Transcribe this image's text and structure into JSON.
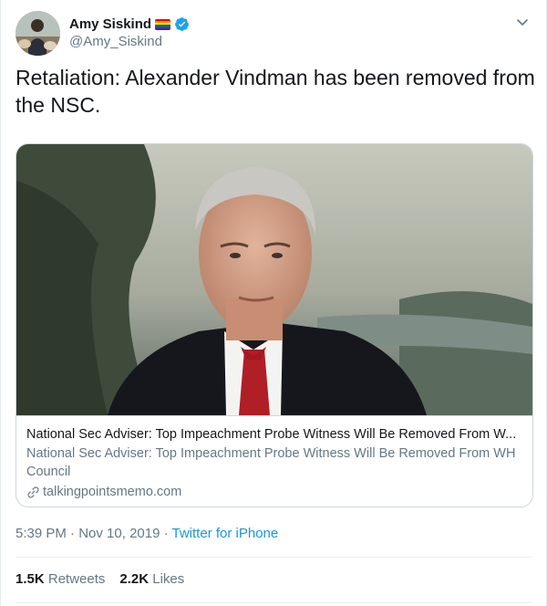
{
  "user": {
    "display_name": "Amy Siskind",
    "handle": "@Amy_Siskind",
    "flag_icon": "rainbow-flag-icon",
    "verified_icon": "verified-badge-icon"
  },
  "tweet": {
    "text": "Retaliation: Alexander Vindman has been removed from the NSC."
  },
  "card": {
    "title": "National Sec Adviser: Top Impeachment Probe Witness Will Be Removed From W...",
    "description": "National Sec Adviser: Top Impeachment Probe Witness Will Be Removed From WH Council",
    "domain": "talkingpointsmemo.com",
    "link_icon": "link-icon"
  },
  "meta": {
    "time": "5:39 PM",
    "sep1": " · ",
    "date": "Nov 10, 2019",
    "sep2": " · ",
    "source": "Twitter for iPhone"
  },
  "stats": {
    "retweets_count": "1.5K",
    "retweets_label": "Retweets",
    "likes_count": "2.2K",
    "likes_label": "Likes"
  },
  "colors": {
    "accent": "#1b95e0",
    "verified": "#1da1f2",
    "secondary_text": "#657786"
  }
}
